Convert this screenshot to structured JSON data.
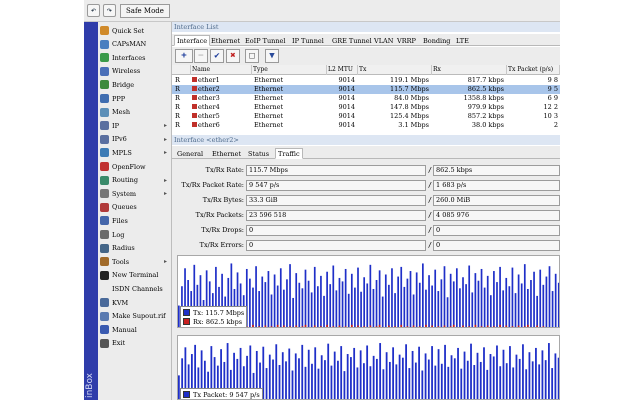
{
  "toolbar": {
    "undo_icon": "undo-icon",
    "redo_icon": "redo-icon",
    "safe_mode_label": "Safe Mode"
  },
  "sidebar": {
    "brand": "inBox",
    "items": [
      {
        "label": "Quick Set",
        "icon": "quick-set-icon",
        "color": "#d08a2a",
        "arrow": ""
      },
      {
        "label": "CAPsMAN",
        "icon": "capsman-icon",
        "color": "#4a7fc0",
        "arrow": ""
      },
      {
        "label": "Interfaces",
        "icon": "interfaces-icon",
        "color": "#3a9a4a",
        "arrow": ""
      },
      {
        "label": "Wireless",
        "icon": "wireless-icon",
        "color": "#4a6fb8",
        "arrow": ""
      },
      {
        "label": "Bridge",
        "icon": "bridge-icon",
        "color": "#3b8a3b",
        "arrow": ""
      },
      {
        "label": "PPP",
        "icon": "ppp-icon",
        "color": "#3f6db0",
        "arrow": ""
      },
      {
        "label": "Mesh",
        "icon": "mesh-icon",
        "color": "#5c8fb8",
        "arrow": ""
      },
      {
        "label": "IP",
        "icon": "ip-icon",
        "color": "#5a6fa0",
        "arrow": "▸"
      },
      {
        "label": "IPv6",
        "icon": "ipv6-icon",
        "color": "#5a6fa0",
        "arrow": "▸"
      },
      {
        "label": "MPLS",
        "icon": "mpls-icon",
        "color": "#3d7bb5",
        "arrow": "▸"
      },
      {
        "label": "OpenFlow",
        "icon": "openflow-icon",
        "color": "#c03030",
        "arrow": ""
      },
      {
        "label": "Routing",
        "icon": "routing-icon",
        "color": "#3a8a6a",
        "arrow": "▸"
      },
      {
        "label": "System",
        "icon": "system-icon",
        "color": "#777777",
        "arrow": "▸"
      },
      {
        "label": "Queues",
        "icon": "queues-icon",
        "color": "#b03a3a",
        "arrow": ""
      },
      {
        "label": "Files",
        "icon": "files-icon",
        "color": "#4466aa",
        "arrow": ""
      },
      {
        "label": "Log",
        "icon": "log-icon",
        "color": "#6a6a6a",
        "arrow": ""
      },
      {
        "label": "Radius",
        "icon": "radius-icon",
        "color": "#446688",
        "arrow": ""
      },
      {
        "label": "Tools",
        "icon": "tools-icon",
        "color": "#a06a2a",
        "arrow": "▸"
      },
      {
        "label": "New Terminal",
        "icon": "terminal-icon",
        "color": "#222222",
        "arrow": ""
      },
      {
        "label": "ISDN Channels",
        "icon": "isdn-icon",
        "color": "#ececec",
        "arrow": ""
      },
      {
        "label": "KVM",
        "icon": "kvm-icon",
        "color": "#4a6a9a",
        "arrow": ""
      },
      {
        "label": "Make Supout.rif",
        "icon": "supout-icon",
        "color": "#5a7ab0",
        "arrow": ""
      },
      {
        "label": "Manual",
        "icon": "manual-icon",
        "color": "#3a5ab0",
        "arrow": ""
      },
      {
        "label": "Exit",
        "icon": "exit-icon",
        "color": "#555555",
        "arrow": ""
      }
    ]
  },
  "iface_window": {
    "title": "Interface List",
    "tabs": [
      "Interface",
      "Ethernet",
      "EoIP Tunnel",
      "IP Tunnel",
      "GRE Tunnel",
      "VLAN",
      "VRRP",
      "Bonding",
      "LTE"
    ],
    "active_tab": 0,
    "tools": [
      {
        "glyph": "+",
        "name": "add-button",
        "color": "#1a3a9a"
      },
      {
        "glyph": "−",
        "name": "remove-button",
        "color": "#bbbbbb"
      },
      {
        "glyph": "✔",
        "name": "enable-button",
        "color": "#1a3a9a"
      },
      {
        "glyph": "✖",
        "name": "disable-button",
        "color": "#c02020"
      },
      {
        "glyph": "□",
        "name": "comment-button",
        "color": "#555555"
      },
      {
        "glyph": "▼",
        "name": "filter-button",
        "color": "#2a4a9a"
      }
    ],
    "columns": [
      "",
      "Name",
      "Type",
      "L2 MTU",
      "Tx",
      "Rx",
      "Tx Packet (p/s)"
    ],
    "rows": [
      {
        "flag": "R",
        "name": "ether1",
        "type": "Ethernet",
        "mtu": "9014",
        "tx": "119.1 Mbps",
        "rx": "817.7 kbps",
        "txp": "9 8",
        "selected": false
      },
      {
        "flag": "R",
        "name": "ether2",
        "type": "Ethernet",
        "mtu": "9014",
        "tx": "115.7 Mbps",
        "rx": "862.5 kbps",
        "txp": "9 5",
        "selected": true
      },
      {
        "flag": "R",
        "name": "ether3",
        "type": "Ethernet",
        "mtu": "9014",
        "tx": "84.0 Mbps",
        "rx": "1358.8 kbps",
        "txp": "6 9",
        "selected": false
      },
      {
        "flag": "R",
        "name": "ether4",
        "type": "Ethernet",
        "mtu": "9014",
        "tx": "147.8 Mbps",
        "rx": "979.9 kbps",
        "txp": "12 2",
        "selected": false
      },
      {
        "flag": "R",
        "name": "ether5",
        "type": "Ethernet",
        "mtu": "9014",
        "tx": "125.4 Mbps",
        "rx": "857.2 kbps",
        "txp": "10 3",
        "selected": false
      },
      {
        "flag": "R",
        "name": "ether6",
        "type": "Ethernet",
        "mtu": "9014",
        "tx": "3.1 Mbps",
        "rx": "38.0 kbps",
        "txp": "2",
        "selected": false
      }
    ]
  },
  "detail_window": {
    "title": "Interface <ether2>",
    "tabs": [
      "General",
      "Ethernet",
      "Status",
      "Traffic"
    ],
    "active_tab": 3,
    "fields": [
      {
        "label": "Tx/Rx Rate:",
        "tx": "115.7 Mbps",
        "rx": "862.5 kbps"
      },
      {
        "label": "Tx/Rx Packet Rate:",
        "tx": "9 547 p/s",
        "rx": "1 683 p/s"
      },
      {
        "label": "Tx/Rx Bytes:",
        "tx": "33.3 GiB",
        "rx": "260.0 MiB"
      },
      {
        "label": "Tx/Rx Packets:",
        "tx": "23 596 518",
        "rx": "4 085 976"
      },
      {
        "label": "Tx/Rx Drops:",
        "tx": "0",
        "rx": "0"
      },
      {
        "label": "Tx/Rx Errors:",
        "tx": "0",
        "rx": "0"
      }
    ],
    "graph1": {
      "legend": [
        {
          "label": "Tx:",
          "value": "115.7 Mbps",
          "color": "#1f2fc8"
        },
        {
          "label": "Rx:",
          "value": "862.5 kbps",
          "color": "#c81f1f"
        }
      ],
      "tx_series": [
        0.34,
        0.62,
        0.88,
        0.71,
        0.55,
        0.93,
        0.64,
        0.78,
        0.42,
        0.85,
        0.69,
        0.52,
        0.9,
        0.61,
        0.8,
        0.47,
        0.74,
        0.95,
        0.58,
        0.82,
        0.66,
        0.49,
        0.87,
        0.73,
        0.6,
        0.91,
        0.55,
        0.76,
        0.68,
        0.84,
        0.5,
        0.79,
        0.63,
        0.88,
        0.57,
        0.72,
        0.94,
        0.45,
        0.81,
        0.67,
        0.59,
        0.86,
        0.7,
        0.53,
        0.9,
        0.62,
        0.77,
        0.48,
        0.83,
        0.65,
        0.92,
        0.56,
        0.74,
        0.69,
        0.87,
        0.51,
        0.8,
        0.6,
        0.89,
        0.54,
        0.75,
        0.66,
        0.93,
        0.58,
        0.71,
        0.85,
        0.47,
        0.79,
        0.64,
        0.88,
        0.52,
        0.76,
        0.9,
        0.61,
        0.73,
        0.84,
        0.5,
        0.82,
        0.67,
        0.95,
        0.57,
        0.78,
        0.63,
        0.86,
        0.55,
        0.72,
        0.91,
        0.46,
        0.8,
        0.69,
        0.88,
        0.59,
        0.75,
        0.65,
        0.92,
        0.53,
        0.81,
        0.7,
        0.87,
        0.6,
        0.77,
        0.49,
        0.84,
        0.68,
        0.9,
        0.56,
        0.74,
        0.62,
        0.89,
        0.52,
        0.79,
        0.66,
        0.94,
        0.58,
        0.71,
        0.83,
        0.48,
        0.86,
        0.64,
        0.76,
        0.91,
        0.55,
        0.8,
        0.67
      ],
      "rx_series": [
        0.02,
        0.04,
        0.03,
        0.05,
        0.02,
        0.04,
        0.03,
        0.06,
        0.02,
        0.03,
        0.05,
        0.02,
        0.04,
        0.03,
        0.05,
        0.02,
        0.04,
        0.06,
        0.03,
        0.02,
        0.05,
        0.03,
        0.04,
        0.02,
        0.06,
        0.03,
        0.04,
        0.02,
        0.05,
        0.03,
        0.04,
        0.02,
        0.06,
        0.03,
        0.05,
        0.02,
        0.04,
        0.03,
        0.05,
        0.02,
        0.04,
        0.06,
        0.03,
        0.02,
        0.05,
        0.03,
        0.04,
        0.02,
        0.06,
        0.03,
        0.04,
        0.02,
        0.05,
        0.03,
        0.04,
        0.02,
        0.06,
        0.03,
        0.05,
        0.02,
        0.04,
        0.03,
        0.05,
        0.02,
        0.04,
        0.06,
        0.03,
        0.02,
        0.05,
        0.03,
        0.04,
        0.02,
        0.06,
        0.03,
        0.04,
        0.02,
        0.05,
        0.03,
        0.04,
        0.02,
        0.06,
        0.03,
        0.05,
        0.02,
        0.04,
        0.03,
        0.05,
        0.02,
        0.04,
        0.06,
        0.03,
        0.02,
        0.05,
        0.03,
        0.04,
        0.02,
        0.06,
        0.03,
        0.04,
        0.02,
        0.05,
        0.03,
        0.04,
        0.02,
        0.06,
        0.03,
        0.05,
        0.02,
        0.04,
        0.03,
        0.05,
        0.02,
        0.04,
        0.06,
        0.03,
        0.02,
        0.05,
        0.03,
        0.04,
        0.02
      ]
    },
    "graph2": {
      "legend": [
        {
          "label": "Tx Packet:",
          "value": "9 547 p/s",
          "color": "#1f2fc8"
        }
      ],
      "tx_series": [
        0.42,
        0.7,
        0.88,
        0.6,
        0.77,
        0.92,
        0.55,
        0.83,
        0.66,
        0.48,
        0.9,
        0.72,
        0.58,
        0.85,
        0.64,
        0.95,
        0.51,
        0.79,
        0.69,
        0.87,
        0.57,
        0.74,
        0.91,
        0.46,
        0.82,
        0.63,
        0.89,
        0.54,
        0.76,
        0.68,
        0.93,
        0.59,
        0.8,
        0.65,
        0.86,
        0.5,
        0.78,
        0.7,
        0.92,
        0.56,
        0.84,
        0.61,
        0.88,
        0.53,
        0.75,
        0.67,
        0.94,
        0.58,
        0.81,
        0.66,
        0.9,
        0.49,
        0.77,
        0.72,
        0.87,
        0.55,
        0.83,
        0.62,
        0.91,
        0.57,
        0.74,
        0.69,
        0.95,
        0.52,
        0.8,
        0.64,
        0.88,
        0.6,
        0.76,
        0.71,
        0.93,
        0.54,
        0.82,
        0.63,
        0.89,
        0.5,
        0.78,
        0.68,
        0.9,
        0.58,
        0.85,
        0.61,
        0.92,
        0.56,
        0.75,
        0.7,
        0.87,
        0.53,
        0.81,
        0.66,
        0.94,
        0.59,
        0.79,
        0.64,
        0.88,
        0.51,
        0.77,
        0.73,
        0.91,
        0.57,
        0.84,
        0.62,
        0.9,
        0.55,
        0.76,
        0.69,
        0.93,
        0.52,
        0.8,
        0.65,
        0.87,
        0.6,
        0.83,
        0.67,
        0.95,
        0.54,
        0.78,
        0.71
      ]
    }
  }
}
